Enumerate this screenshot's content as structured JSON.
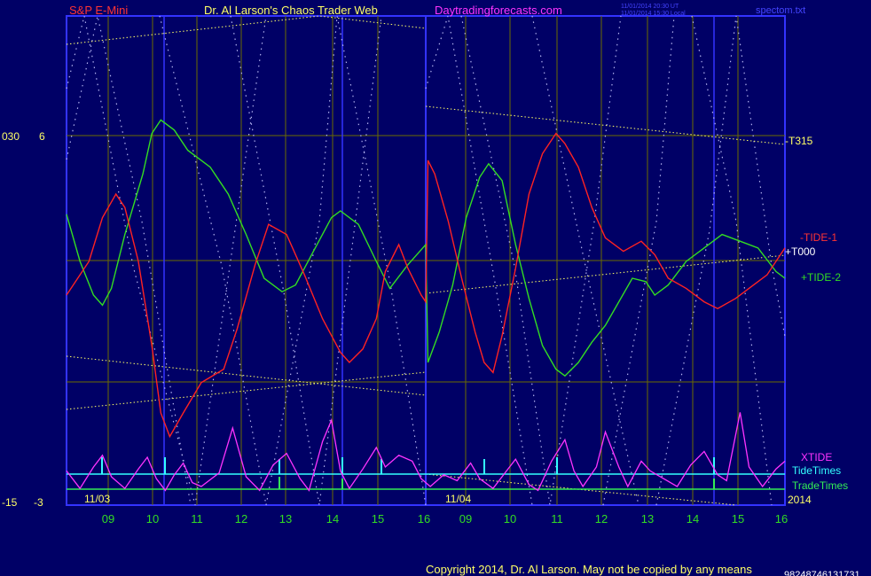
{
  "header": {
    "symbol": "S&P E-Mini",
    "brand": "Dr. Al Larson's Chaos Trader Web",
    "site": "Daytradingforecasts.com",
    "stamp_utc": "11/01/2014 20:30 UT",
    "stamp_local": "11/01/2014 15:30 Local",
    "file": "spectom.txt"
  },
  "left_axis": {
    "top_left": "030",
    "top_right": "6",
    "bottom_left": "-15",
    "bottom_right": "-3"
  },
  "footer": {
    "copyright": "Copyright 2014, Dr. Al Larson. May not be copied by any means",
    "serial": "98248746131731",
    "year": "2014"
  },
  "colors": {
    "background": "#000066",
    "frame": "#3333ff",
    "tide1": "#ff2222",
    "tide2": "#33dd22",
    "xtide": "#ff33ff",
    "tidetimes": "#33ffff",
    "tradetimes": "#33ee55",
    "trendline": "#ffff66",
    "grid": "#6b6b00"
  },
  "chart_data": {
    "type": "line",
    "title": "S&P E-Mini",
    "x_day_labels": [
      "11/03",
      "11/04"
    ],
    "x_hour_ticks": [
      "09",
      "10",
      "11",
      "12",
      "13",
      "14",
      "15",
      "16",
      "09",
      "10",
      "11",
      "12",
      "13",
      "14",
      "15",
      "16"
    ],
    "series_labels": {
      "t315": "-T315",
      "tide1": "-TIDE-1",
      "t000": "+T000",
      "tide2": "+TIDE-2",
      "xtide": "XTIDE",
      "tidetimes": "TideTimes",
      "tradetimes": "TradeTimes"
    },
    "x_range_hours": [
      0,
      16
    ],
    "y_range": [
      0,
      100
    ],
    "tide1": [
      [
        0,
        40
      ],
      [
        0.5,
        50
      ],
      [
        0.8,
        63
      ],
      [
        1.1,
        70
      ],
      [
        1.3,
        66
      ],
      [
        1.6,
        50
      ],
      [
        1.9,
        25
      ],
      [
        2.1,
        5
      ],
      [
        2.3,
        -2
      ],
      [
        2.6,
        5
      ],
      [
        3.0,
        14
      ],
      [
        3.5,
        18
      ],
      [
        3.8,
        30
      ],
      [
        4.2,
        49
      ],
      [
        4.5,
        61
      ],
      [
        4.9,
        58
      ],
      [
        5.3,
        46
      ],
      [
        5.7,
        33
      ],
      [
        6.1,
        23
      ],
      [
        6.3,
        20
      ],
      [
        6.6,
        24
      ],
      [
        6.9,
        33
      ],
      [
        7.1,
        47
      ],
      [
        7.4,
        55
      ],
      [
        7.6,
        48
      ],
      [
        7.9,
        40
      ],
      [
        8.0,
        38
      ],
      [
        8.05,
        80
      ],
      [
        8.2,
        76
      ],
      [
        8.5,
        62
      ],
      [
        8.8,
        45
      ],
      [
        9.1,
        29
      ],
      [
        9.3,
        20
      ],
      [
        9.5,
        17
      ],
      [
        9.7,
        28
      ],
      [
        10.0,
        48
      ],
      [
        10.3,
        70
      ],
      [
        10.6,
        82
      ],
      [
        10.9,
        88
      ],
      [
        11.1,
        85
      ],
      [
        11.4,
        78
      ],
      [
        11.7,
        66
      ],
      [
        12.0,
        57
      ],
      [
        12.4,
        53
      ],
      [
        12.8,
        56
      ],
      [
        13.1,
        52
      ],
      [
        13.4,
        45
      ],
      [
        13.8,
        42
      ],
      [
        14.2,
        38
      ],
      [
        14.5,
        36
      ],
      [
        14.9,
        39
      ],
      [
        15.3,
        43
      ],
      [
        15.6,
        46
      ],
      [
        15.9,
        52
      ],
      [
        16,
        54
      ]
    ],
    "tide2": [
      [
        0,
        64
      ],
      [
        0.3,
        50
      ],
      [
        0.6,
        40
      ],
      [
        0.8,
        37
      ],
      [
        1.0,
        42
      ],
      [
        1.3,
        58
      ],
      [
        1.7,
        76
      ],
      [
        1.9,
        88
      ],
      [
        2.1,
        92
      ],
      [
        2.4,
        89
      ],
      [
        2.7,
        83
      ],
      [
        3.2,
        78
      ],
      [
        3.6,
        70
      ],
      [
        4.0,
        58
      ],
      [
        4.4,
        45
      ],
      [
        4.8,
        41
      ],
      [
        5.1,
        43
      ],
      [
        5.5,
        53
      ],
      [
        5.9,
        63
      ],
      [
        6.1,
        65
      ],
      [
        6.5,
        61
      ],
      [
        6.9,
        50
      ],
      [
        7.2,
        42
      ],
      [
        7.6,
        49
      ],
      [
        8.0,
        55
      ],
      [
        8.05,
        20
      ],
      [
        8.3,
        29
      ],
      [
        8.6,
        43
      ],
      [
        8.9,
        63
      ],
      [
        9.2,
        75
      ],
      [
        9.4,
        79
      ],
      [
        9.7,
        74
      ],
      [
        10.0,
        55
      ],
      [
        10.3,
        39
      ],
      [
        10.6,
        25
      ],
      [
        10.9,
        18
      ],
      [
        11.1,
        16
      ],
      [
        11.4,
        20
      ],
      [
        11.7,
        26
      ],
      [
        12.0,
        31
      ],
      [
        12.3,
        38
      ],
      [
        12.6,
        45
      ],
      [
        12.9,
        44
      ],
      [
        13.1,
        40
      ],
      [
        13.4,
        43
      ],
      [
        13.8,
        50
      ],
      [
        14.2,
        54
      ],
      [
        14.6,
        58
      ],
      [
        15.0,
        56
      ],
      [
        15.4,
        54
      ],
      [
        15.8,
        47
      ],
      [
        16,
        45
      ]
    ],
    "xtide": [
      [
        0,
        13
      ],
      [
        0.3,
        4
      ],
      [
        0.6,
        15
      ],
      [
        0.8,
        21
      ],
      [
        1.0,
        10
      ],
      [
        1.3,
        4
      ],
      [
        1.6,
        14
      ],
      [
        1.8,
        20
      ],
      [
        2.0,
        9
      ],
      [
        2.2,
        3
      ],
      [
        2.4,
        11
      ],
      [
        2.6,
        17
      ],
      [
        2.8,
        7
      ],
      [
        3.0,
        5
      ],
      [
        3.4,
        12
      ],
      [
        3.7,
        35
      ],
      [
        4.0,
        10
      ],
      [
        4.3,
        3
      ],
      [
        4.6,
        16
      ],
      [
        4.9,
        22
      ],
      [
        5.2,
        9
      ],
      [
        5.4,
        3
      ],
      [
        5.7,
        28
      ],
      [
        5.9,
        39
      ],
      [
        6.1,
        13
      ],
      [
        6.3,
        4
      ],
      [
        6.6,
        14
      ],
      [
        6.9,
        25
      ],
      [
        7.1,
        15
      ],
      [
        7.4,
        21
      ],
      [
        7.7,
        18
      ],
      [
        7.9,
        9
      ],
      [
        8.1,
        5
      ],
      [
        8.4,
        11
      ],
      [
        8.7,
        8
      ],
      [
        9.0,
        17
      ],
      [
        9.2,
        9
      ],
      [
        9.5,
        4
      ],
      [
        9.8,
        13
      ],
      [
        10.0,
        19
      ],
      [
        10.3,
        6
      ],
      [
        10.5,
        3
      ],
      [
        10.8,
        18
      ],
      [
        11.1,
        29
      ],
      [
        11.3,
        13
      ],
      [
        11.5,
        5
      ],
      [
        11.8,
        15
      ],
      [
        12.0,
        33
      ],
      [
        12.3,
        15
      ],
      [
        12.5,
        5
      ],
      [
        12.8,
        18
      ],
      [
        13.0,
        13
      ],
      [
        13.3,
        9
      ],
      [
        13.6,
        5
      ],
      [
        13.9,
        16
      ],
      [
        14.2,
        23
      ],
      [
        14.5,
        11
      ],
      [
        14.7,
        8
      ],
      [
        15.0,
        43
      ],
      [
        15.2,
        15
      ],
      [
        15.5,
        5
      ],
      [
        15.8,
        14
      ],
      [
        16,
        18
      ]
    ]
  }
}
